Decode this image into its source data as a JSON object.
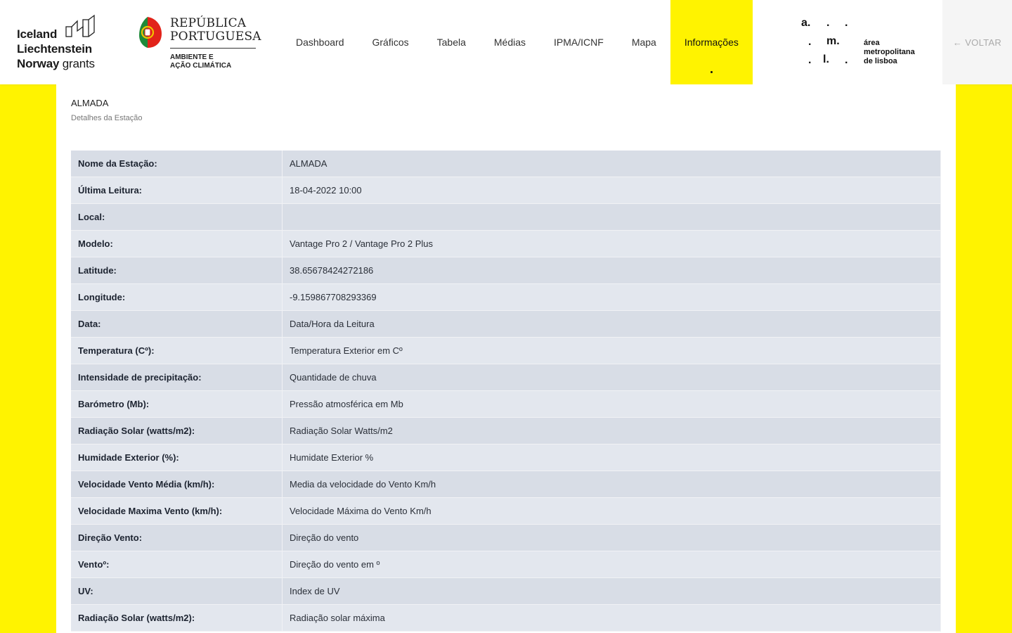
{
  "header": {
    "eea_logo": {
      "line1": "Iceland",
      "line2": "Liechtenstein",
      "line3_bold": "Norway",
      "line3_light": "grants"
    },
    "rp_logo": {
      "line1": "REPÚBLICA",
      "line2": "PORTUGUESA",
      "sub1": "AMBIENTE E",
      "sub2": "AÇÃO CLIMÁTICA"
    },
    "nav": [
      {
        "label": "Dashboard"
      },
      {
        "label": "Gráficos"
      },
      {
        "label": "Tabela"
      },
      {
        "label": "Médias"
      },
      {
        "label": "IPMA/ICNF"
      },
      {
        "label": "Mapa"
      },
      {
        "label": "Informações",
        "active": true
      }
    ],
    "aml_logo": {
      "mark_a": "a.",
      "mark_m": "m.",
      "mark_l": "l.",
      "line1": "área",
      "line2": "metropolitana",
      "line3": "de lisboa"
    },
    "back_label": "VOLTAR"
  },
  "station": {
    "name": "ALMADA",
    "subtitle": "Detalhes da Estação"
  },
  "details": [
    {
      "label": "Nome da Estação:",
      "value": "ALMADA"
    },
    {
      "label": "Última Leitura:",
      "value": "18-04-2022 10:00"
    },
    {
      "label": "Local:",
      "value": ""
    },
    {
      "label": "Modelo:",
      "value": "Vantage Pro 2 / Vantage Pro 2 Plus"
    },
    {
      "label": "Latitude:",
      "value": "38.65678424272186"
    },
    {
      "label": "Longitude:",
      "value": "-9.159867708293369"
    },
    {
      "label": "Data:",
      "value": "Data/Hora da Leitura"
    },
    {
      "label": "Temperatura (Cº):",
      "value": "Temperatura Exterior em Cº"
    },
    {
      "label": "Intensidade de precipitação:",
      "value": "Quantidade de chuva"
    },
    {
      "label": "Barómetro (Mb):",
      "value": "Pressão atmosférica em Mb"
    },
    {
      "label": "Radiação Solar (watts/m2):",
      "value": "Radiação Solar Watts/m2"
    },
    {
      "label": "Humidade Exterior (%):",
      "value": "Humidate Exterior %"
    },
    {
      "label": "Velocidade Vento Média (km/h):",
      "value": "Media da velocidade do Vento Km/h"
    },
    {
      "label": "Velocidade Maxima Vento (km/h):",
      "value": "Velocidade Máxima do Vento Km/h"
    },
    {
      "label": "Direção Vento:",
      "value": "Direção do vento"
    },
    {
      "label": "Ventoº:",
      "value": "Direção do vento em º"
    },
    {
      "label": "UV:",
      "value": "Index de UV"
    },
    {
      "label": "Radiação Solar (watts/m2):",
      "value": "Radiação solar máxima"
    }
  ],
  "colors": {
    "accent": "#fff300",
    "row_dark": "#d8dde6",
    "row_light": "#e3e7ee"
  },
  "icons": {
    "back": "arrow-left-icon",
    "flag": "portugal-flag-icon",
    "grants": "eea-grants-icon"
  }
}
